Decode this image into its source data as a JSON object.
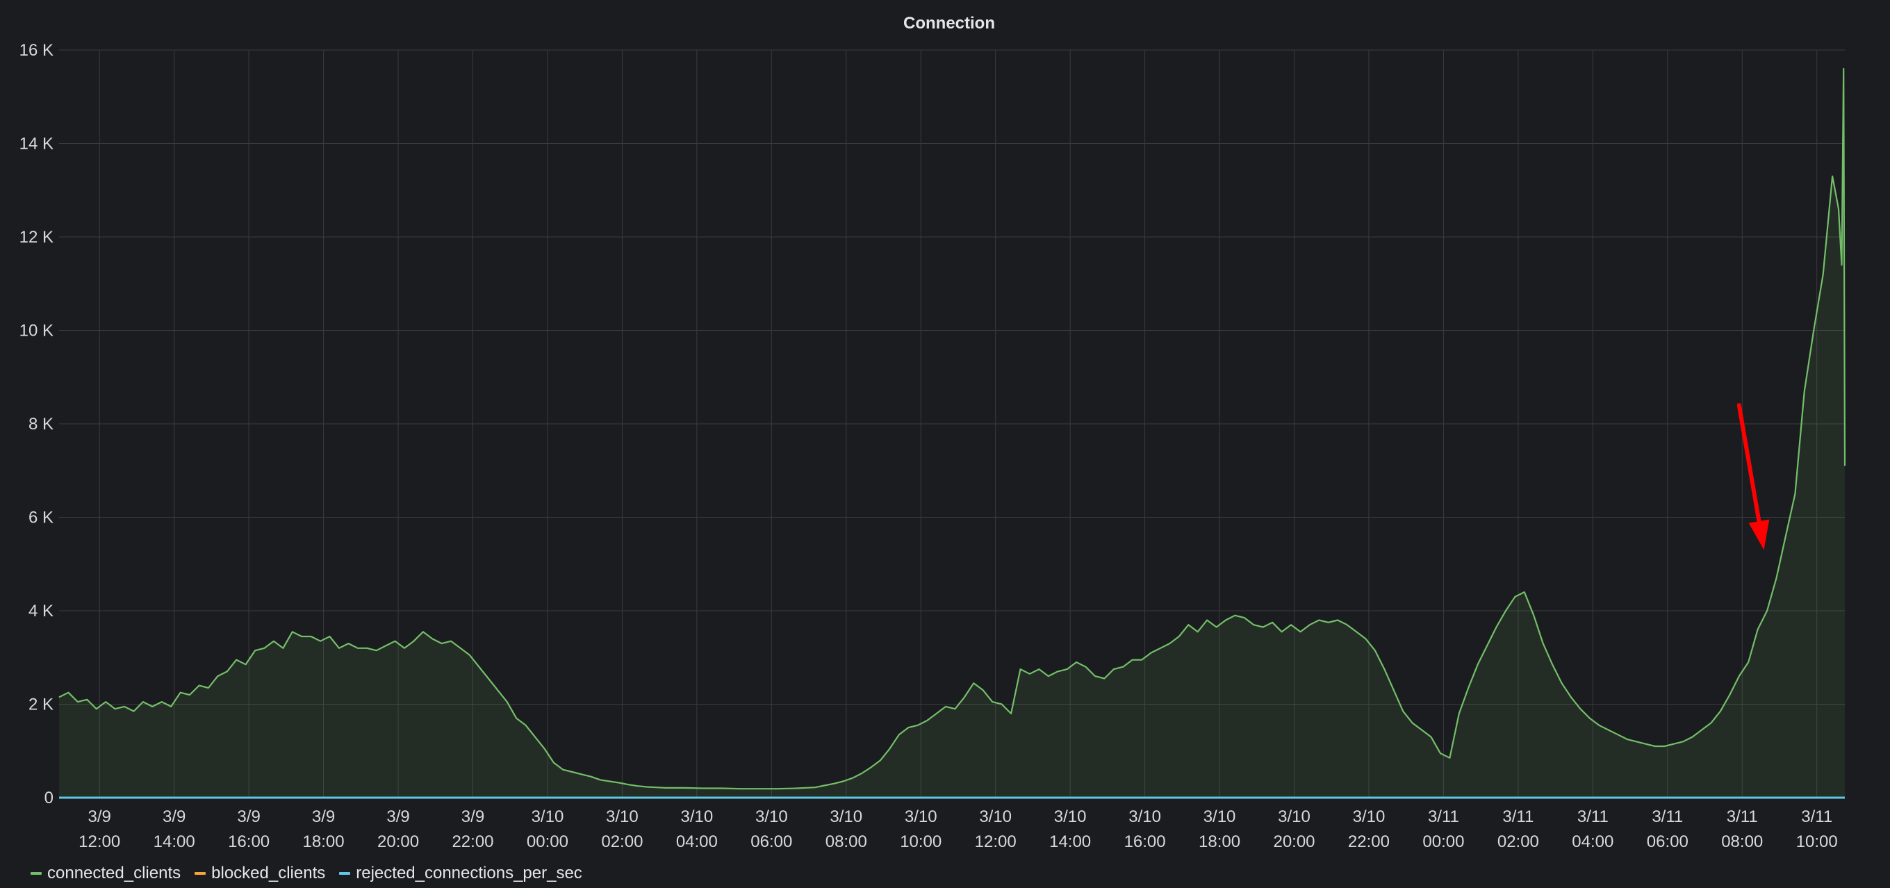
{
  "chart_data": {
    "type": "area",
    "title": "Connection",
    "xlabel": "",
    "ylabel": "",
    "ylim": [
      0,
      16000
    ],
    "y_ticks": [
      {
        "value": 0,
        "label": "0"
      },
      {
        "value": 2000,
        "label": "2 K"
      },
      {
        "value": 4000,
        "label": "4 K"
      },
      {
        "value": 6000,
        "label": "6 K"
      },
      {
        "value": 8000,
        "label": "8 K"
      },
      {
        "value": 10000,
        "label": "10 K"
      },
      {
        "value": 12000,
        "label": "12 K"
      },
      {
        "value": 14000,
        "label": "14 K"
      },
      {
        "value": 16000,
        "label": "16 K"
      }
    ],
    "xlim": [
      "3/9 10:55",
      "3/11 10:45"
    ],
    "x_ticks": [
      {
        "date": "3/9",
        "time": "12:00"
      },
      {
        "date": "3/9",
        "time": "14:00"
      },
      {
        "date": "3/9",
        "time": "16:00"
      },
      {
        "date": "3/9",
        "time": "18:00"
      },
      {
        "date": "3/9",
        "time": "20:00"
      },
      {
        "date": "3/9",
        "time": "22:00"
      },
      {
        "date": "3/10",
        "time": "00:00"
      },
      {
        "date": "3/10",
        "time": "02:00"
      },
      {
        "date": "3/10",
        "time": "04:00"
      },
      {
        "date": "3/10",
        "time": "06:00"
      },
      {
        "date": "3/10",
        "time": "08:00"
      },
      {
        "date": "3/10",
        "time": "10:00"
      },
      {
        "date": "3/10",
        "time": "12:00"
      },
      {
        "date": "3/10",
        "time": "14:00"
      },
      {
        "date": "3/10",
        "time": "16:00"
      },
      {
        "date": "3/10",
        "time": "18:00"
      },
      {
        "date": "3/10",
        "time": "20:00"
      },
      {
        "date": "3/10",
        "time": "22:00"
      },
      {
        "date": "3/11",
        "time": "00:00"
      },
      {
        "date": "3/11",
        "time": "02:00"
      },
      {
        "date": "3/11",
        "time": "04:00"
      },
      {
        "date": "3/11",
        "time": "06:00"
      },
      {
        "date": "3/11",
        "time": "08:00"
      },
      {
        "date": "3/11",
        "time": "10:00"
      }
    ],
    "grid": true,
    "legend_position": "bottom-left",
    "series": [
      {
        "name": "connected_clients",
        "color": "#73bf69",
        "points": [
          [
            "3/9 10:55",
            2150
          ],
          [
            "3/9 11:10",
            2250
          ],
          [
            "3/9 11:25",
            2050
          ],
          [
            "3/9 11:40",
            2100
          ],
          [
            "3/9 11:55",
            1900
          ],
          [
            "3/9 12:10",
            2050
          ],
          [
            "3/9 12:25",
            1900
          ],
          [
            "3/9 12:40",
            1950
          ],
          [
            "3/9 12:55",
            1850
          ],
          [
            "3/9 13:10",
            2050
          ],
          [
            "3/9 13:25",
            1950
          ],
          [
            "3/9 13:40",
            2050
          ],
          [
            "3/9 13:55",
            1950
          ],
          [
            "3/9 14:10",
            2250
          ],
          [
            "3/9 14:25",
            2200
          ],
          [
            "3/9 14:40",
            2400
          ],
          [
            "3/9 14:55",
            2350
          ],
          [
            "3/9 15:10",
            2600
          ],
          [
            "3/9 15:25",
            2700
          ],
          [
            "3/9 15:40",
            2950
          ],
          [
            "3/9 15:55",
            2850
          ],
          [
            "3/9 16:10",
            3150
          ],
          [
            "3/9 16:25",
            3200
          ],
          [
            "3/9 16:40",
            3350
          ],
          [
            "3/9 16:55",
            3200
          ],
          [
            "3/9 17:10",
            3550
          ],
          [
            "3/9 17:25",
            3450
          ],
          [
            "3/9 17:40",
            3450
          ],
          [
            "3/9 17:55",
            3350
          ],
          [
            "3/9 18:10",
            3450
          ],
          [
            "3/9 18:25",
            3200
          ],
          [
            "3/9 18:40",
            3300
          ],
          [
            "3/9 18:55",
            3200
          ],
          [
            "3/9 19:10",
            3200
          ],
          [
            "3/9 19:25",
            3150
          ],
          [
            "3/9 19:40",
            3250
          ],
          [
            "3/9 19:55",
            3350
          ],
          [
            "3/9 20:10",
            3200
          ],
          [
            "3/9 20:25",
            3350
          ],
          [
            "3/9 20:40",
            3550
          ],
          [
            "3/9 20:55",
            3400
          ],
          [
            "3/9 21:10",
            3300
          ],
          [
            "3/9 21:25",
            3350
          ],
          [
            "3/9 21:40",
            3200
          ],
          [
            "3/9 21:55",
            3050
          ],
          [
            "3/9 22:10",
            2800
          ],
          [
            "3/9 22:25",
            2550
          ],
          [
            "3/9 22:40",
            2300
          ],
          [
            "3/9 22:55",
            2050
          ],
          [
            "3/9 23:10",
            1700
          ],
          [
            "3/9 23:25",
            1550
          ],
          [
            "3/9 23:40",
            1300
          ],
          [
            "3/9 23:55",
            1050
          ],
          [
            "3/10 00:10",
            750
          ],
          [
            "3/10 00:25",
            600
          ],
          [
            "3/10 00:40",
            550
          ],
          [
            "3/10 00:55",
            500
          ],
          [
            "3/10 01:10",
            450
          ],
          [
            "3/10 01:25",
            380
          ],
          [
            "3/10 01:40",
            350
          ],
          [
            "3/10 01:55",
            320
          ],
          [
            "3/10 02:10",
            280
          ],
          [
            "3/10 02:25",
            250
          ],
          [
            "3/10 02:40",
            230
          ],
          [
            "3/10 02:55",
            220
          ],
          [
            "3/10 03:10",
            210
          ],
          [
            "3/10 03:40",
            210
          ],
          [
            "3/10 04:10",
            200
          ],
          [
            "3/10 04:40",
            200
          ],
          [
            "3/10 05:10",
            190
          ],
          [
            "3/10 05:40",
            190
          ],
          [
            "3/10 06:10",
            190
          ],
          [
            "3/10 06:40",
            200
          ],
          [
            "3/10 07:10",
            220
          ],
          [
            "3/10 07:25",
            260
          ],
          [
            "3/10 07:40",
            300
          ],
          [
            "3/10 07:55",
            350
          ],
          [
            "3/10 08:10",
            420
          ],
          [
            "3/10 08:25",
            520
          ],
          [
            "3/10 08:40",
            650
          ],
          [
            "3/10 08:55",
            800
          ],
          [
            "3/10 09:10",
            1050
          ],
          [
            "3/10 09:25",
            1350
          ],
          [
            "3/10 09:40",
            1500
          ],
          [
            "3/10 09:55",
            1550
          ],
          [
            "3/10 10:10",
            1650
          ],
          [
            "3/10 10:25",
            1800
          ],
          [
            "3/10 10:40",
            1950
          ],
          [
            "3/10 10:55",
            1900
          ],
          [
            "3/10 11:10",
            2150
          ],
          [
            "3/10 11:25",
            2450
          ],
          [
            "3/10 11:40",
            2300
          ],
          [
            "3/10 11:55",
            2050
          ],
          [
            "3/10 12:10",
            2000
          ],
          [
            "3/10 12:25",
            1800
          ],
          [
            "3/10 12:40",
            2750
          ],
          [
            "3/10 12:55",
            2650
          ],
          [
            "3/10 13:10",
            2750
          ],
          [
            "3/10 13:25",
            2600
          ],
          [
            "3/10 13:40",
            2700
          ],
          [
            "3/10 13:55",
            2750
          ],
          [
            "3/10 14:10",
            2900
          ],
          [
            "3/10 14:25",
            2800
          ],
          [
            "3/10 14:40",
            2600
          ],
          [
            "3/10 14:55",
            2550
          ],
          [
            "3/10 15:10",
            2750
          ],
          [
            "3/10 15:25",
            2800
          ],
          [
            "3/10 15:40",
            2950
          ],
          [
            "3/10 15:55",
            2950
          ],
          [
            "3/10 16:10",
            3100
          ],
          [
            "3/10 16:25",
            3200
          ],
          [
            "3/10 16:40",
            3300
          ],
          [
            "3/10 16:55",
            3450
          ],
          [
            "3/10 17:10",
            3700
          ],
          [
            "3/10 17:25",
            3550
          ],
          [
            "3/10 17:40",
            3800
          ],
          [
            "3/10 17:55",
            3650
          ],
          [
            "3/10 18:10",
            3800
          ],
          [
            "3/10 18:25",
            3900
          ],
          [
            "3/10 18:40",
            3850
          ],
          [
            "3/10 18:55",
            3700
          ],
          [
            "3/10 19:10",
            3650
          ],
          [
            "3/10 19:25",
            3750
          ],
          [
            "3/10 19:40",
            3550
          ],
          [
            "3/10 19:55",
            3700
          ],
          [
            "3/10 20:10",
            3550
          ],
          [
            "3/10 20:25",
            3700
          ],
          [
            "3/10 20:40",
            3800
          ],
          [
            "3/10 20:55",
            3750
          ],
          [
            "3/10 21:10",
            3800
          ],
          [
            "3/10 21:25",
            3700
          ],
          [
            "3/10 21:40",
            3550
          ],
          [
            "3/10 21:55",
            3400
          ],
          [
            "3/10 22:10",
            3150
          ],
          [
            "3/10 22:25",
            2750
          ],
          [
            "3/10 22:40",
            2300
          ],
          [
            "3/10 22:55",
            1850
          ],
          [
            "3/10 23:10",
            1600
          ],
          [
            "3/10 23:25",
            1450
          ],
          [
            "3/10 23:40",
            1300
          ],
          [
            "3/10 23:55",
            950
          ],
          [
            "3/11 00:10",
            850
          ],
          [
            "3/11 00:25",
            1800
          ],
          [
            "3/11 00:40",
            2350
          ],
          [
            "3/11 00:55",
            2850
          ],
          [
            "3/11 01:10",
            3250
          ],
          [
            "3/11 01:25",
            3650
          ],
          [
            "3/11 01:40",
            4000
          ],
          [
            "3/11 01:55",
            4300
          ],
          [
            "3/11 02:10",
            4400
          ],
          [
            "3/11 02:25",
            3900
          ],
          [
            "3/11 02:40",
            3300
          ],
          [
            "3/11 02:55",
            2850
          ],
          [
            "3/11 03:10",
            2450
          ],
          [
            "3/11 03:25",
            2150
          ],
          [
            "3/11 03:40",
            1900
          ],
          [
            "3/11 03:55",
            1700
          ],
          [
            "3/11 04:10",
            1550
          ],
          [
            "3/11 04:25",
            1450
          ],
          [
            "3/11 04:40",
            1350
          ],
          [
            "3/11 04:55",
            1250
          ],
          [
            "3/11 05:10",
            1200
          ],
          [
            "3/11 05:25",
            1150
          ],
          [
            "3/11 05:40",
            1100
          ],
          [
            "3/11 05:55",
            1100
          ],
          [
            "3/11 06:10",
            1150
          ],
          [
            "3/11 06:25",
            1200
          ],
          [
            "3/11 06:40",
            1300
          ],
          [
            "3/11 06:55",
            1450
          ],
          [
            "3/11 07:10",
            1600
          ],
          [
            "3/11 07:25",
            1850
          ],
          [
            "3/11 07:40",
            2200
          ],
          [
            "3/11 07:55",
            2600
          ],
          [
            "3/11 08:10",
            2900
          ],
          [
            "3/11 08:25",
            3600
          ],
          [
            "3/11 08:40",
            4000
          ],
          [
            "3/11 08:55",
            4700
          ],
          [
            "3/11 09:10",
            5600
          ],
          [
            "3/11 09:25",
            6500
          ],
          [
            "3/11 09:40",
            8700
          ],
          [
            "3/11 09:55",
            10000
          ],
          [
            "3/11 10:10",
            11200
          ],
          [
            "3/11 10:25",
            13300
          ],
          [
            "3/11 10:35",
            12600
          ],
          [
            "3/11 10:40",
            11400
          ],
          [
            "3/11 10:43",
            15600
          ],
          [
            "3/11 10:45",
            7100
          ]
        ]
      },
      {
        "name": "blocked_clients",
        "color": "#f2a63a",
        "points": [
          [
            "3/9 10:55",
            0
          ],
          [
            "3/11 10:45",
            0
          ]
        ]
      },
      {
        "name": "rejected_connections_per_sec",
        "color": "#5fc8e6",
        "points": [
          [
            "3/9 10:55",
            0
          ],
          [
            "3/11 10:45",
            0
          ]
        ]
      }
    ],
    "annotations": [
      {
        "type": "arrow",
        "color": "#ff0000",
        "from": [
          "3/11 07:55",
          8400
        ],
        "to": [
          "3/11 08:35",
          5300
        ]
      }
    ]
  },
  "colors": {
    "panel_bg": "#1b1c1f",
    "grid": "#3a3b3e",
    "text": "#d8d9da"
  }
}
